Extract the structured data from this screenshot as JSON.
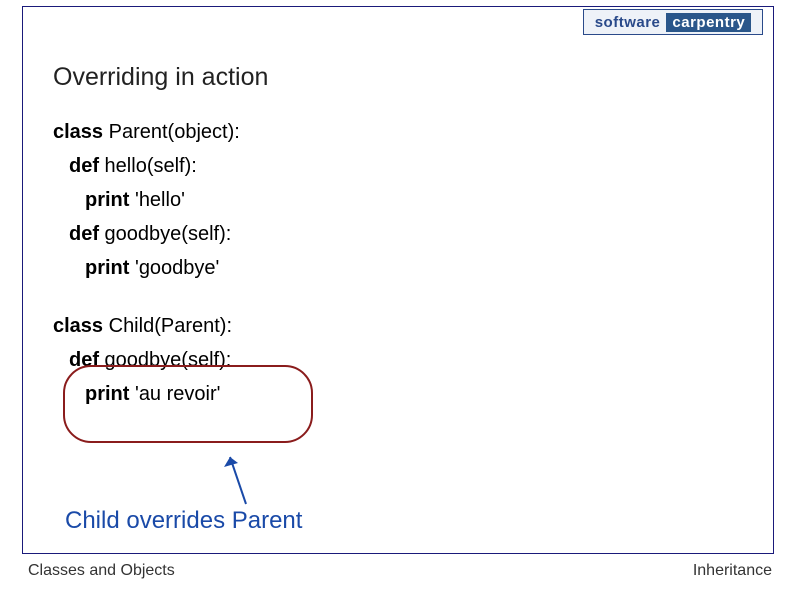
{
  "logo": {
    "word1": "software",
    "word2": "carpentry"
  },
  "title": "Overriding in action",
  "code": {
    "parent": {
      "classLine": {
        "kw": "class",
        "rest": " Parent(object):"
      },
      "hello": {
        "kw": "def",
        "rest": " hello(self):"
      },
      "helloBody": {
        "kw": "print",
        "rest": " 'hello'"
      },
      "goodbye": {
        "kw": "def",
        "rest": " goodbye(self):"
      },
      "goodbyeBody": {
        "kw": "print",
        "rest": " 'goodbye'"
      }
    },
    "child": {
      "classLine": {
        "kw": "class",
        "rest": " Child(Parent):"
      },
      "goodbye": {
        "kw": "def",
        "rest": " goodbye(self):"
      },
      "goodbyeBody": {
        "kw": "print",
        "rest": " 'au revoir'"
      }
    }
  },
  "note": "Child overrides Parent",
  "footer": {
    "left": "Classes and Objects",
    "right": "Inheritance"
  }
}
